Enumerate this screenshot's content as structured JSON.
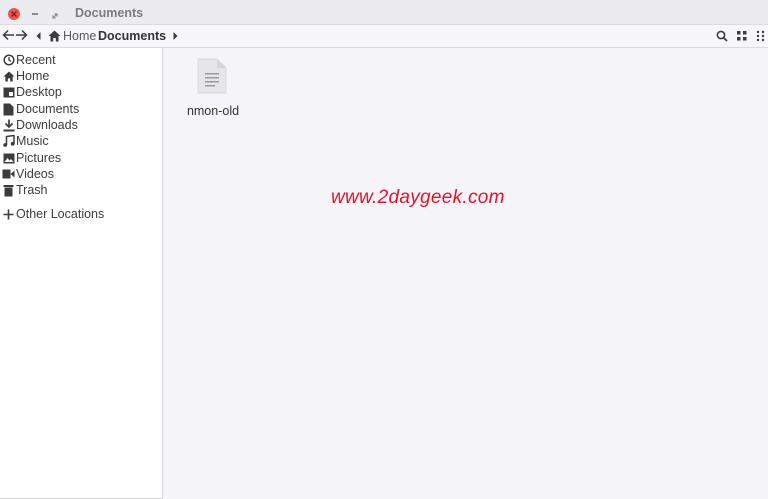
{
  "window": {
    "title": "Documents"
  },
  "breadcrumb": {
    "home": "Home",
    "current": "Documents"
  },
  "sidebar": {
    "items": [
      {
        "label": "Recent",
        "icon": "clock-icon"
      },
      {
        "label": "Home",
        "icon": "home-icon"
      },
      {
        "label": "Desktop",
        "icon": "desktop-icon"
      },
      {
        "label": "Documents",
        "icon": "document-icon"
      },
      {
        "label": "Downloads",
        "icon": "download-icon"
      },
      {
        "label": "Music",
        "icon": "music-icon"
      },
      {
        "label": "Pictures",
        "icon": "picture-icon"
      },
      {
        "label": "Videos",
        "icon": "video-icon"
      },
      {
        "label": "Trash",
        "icon": "trash-icon"
      }
    ],
    "other": {
      "label": "Other Locations",
      "icon": "plus-icon"
    }
  },
  "files": [
    {
      "name": "nmon-old",
      "icon": "text-file-icon"
    }
  ],
  "watermark": "www.2daygeek.com",
  "colors": {
    "close": "#f0544c",
    "watermark": "#e8112d",
    "sidebar_bg": "#ffffff",
    "main_bg": "#f5f5f7"
  }
}
